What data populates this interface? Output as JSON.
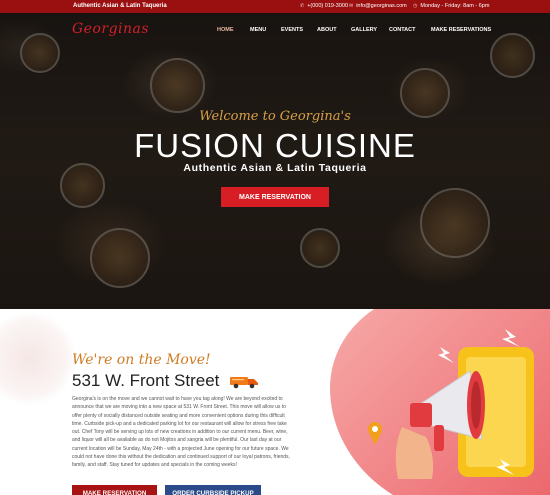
{
  "topbar": {
    "tagline": "Authentic Asian & Latin Taqueria",
    "phone": "+(000) 019-3000",
    "email": "info@georginas.com",
    "hours": "Monday - Friday: 8am - 6pm"
  },
  "nav": {
    "logo": "Georginas",
    "items": [
      "HOME",
      "MENU",
      "EVENTS",
      "ABOUT",
      "GALLERY",
      "CONTACT",
      "MAKE RESERVATIONS"
    ]
  },
  "hero": {
    "welcome": "Welcome to Georgina's",
    "headline": "FUSION CUISINE",
    "subline": "Authentic Asian & Latin Taqueria",
    "button": "MAKE RESERVATION"
  },
  "section": {
    "title": "We're on the Move!",
    "address": "531 W. Front Street",
    "body": "Georgina's is on the move and we cannot wait to have you tag along! We are beyond excited to announce that we are moving into a new space at 531 W. Front Street. This move will allow us to offer plenty of socially distanced outside seating and more convenient options during this difficult time. Curbside pick-up and a dedicated parking lot for our restaurant will allow for stress free take out. Chef Tony will be serving up lots of new creations in addition to our current menu. Beer, wine, and liquor will all be available as do not Mojitos and sangria will be plentiful. Our last day at our current location will be Sunday, May 24th - with a projected June opening for our future space. We could not have done this without the dedication and continued support of our loyal patrons, friends, family, and staff. Stay tuned for updates and specials in the coming weeks!",
    "btn_reservation": "MAKE RESERVATION",
    "btn_curbside": "ORDER CURBSIDE PICKUP"
  },
  "colors": {
    "topbar": "#9a1010",
    "accent_red": "#d81e25",
    "gold": "#d8a047",
    "orange_script": "#d07c24",
    "navy_button": "#2a4a8a"
  }
}
